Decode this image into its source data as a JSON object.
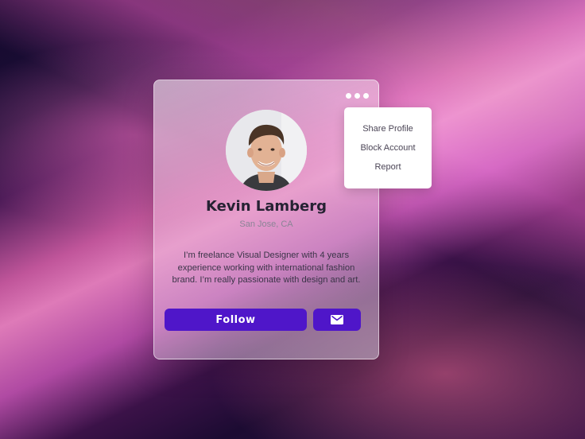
{
  "profile": {
    "name": "Kevin Lamberg",
    "location": "San Jose, CA",
    "bio": "I’m freelance Visual Designer with 4 years experience working with international fashion brand. I’m really passionate with design and art.",
    "follow_label": "Follow",
    "message_icon": "mail-icon",
    "more_icon": "more-dots-icon",
    "avatar_icon": "profile-photo"
  },
  "menu": {
    "items": [
      {
        "label": "Share Profile"
      },
      {
        "label": "Block Account"
      },
      {
        "label": "Report"
      }
    ]
  },
  "colors": {
    "accent": "#4f16c9",
    "name_text": "#262233",
    "background_dark": "#150a2e",
    "background_pink": "#de7ab8"
  }
}
